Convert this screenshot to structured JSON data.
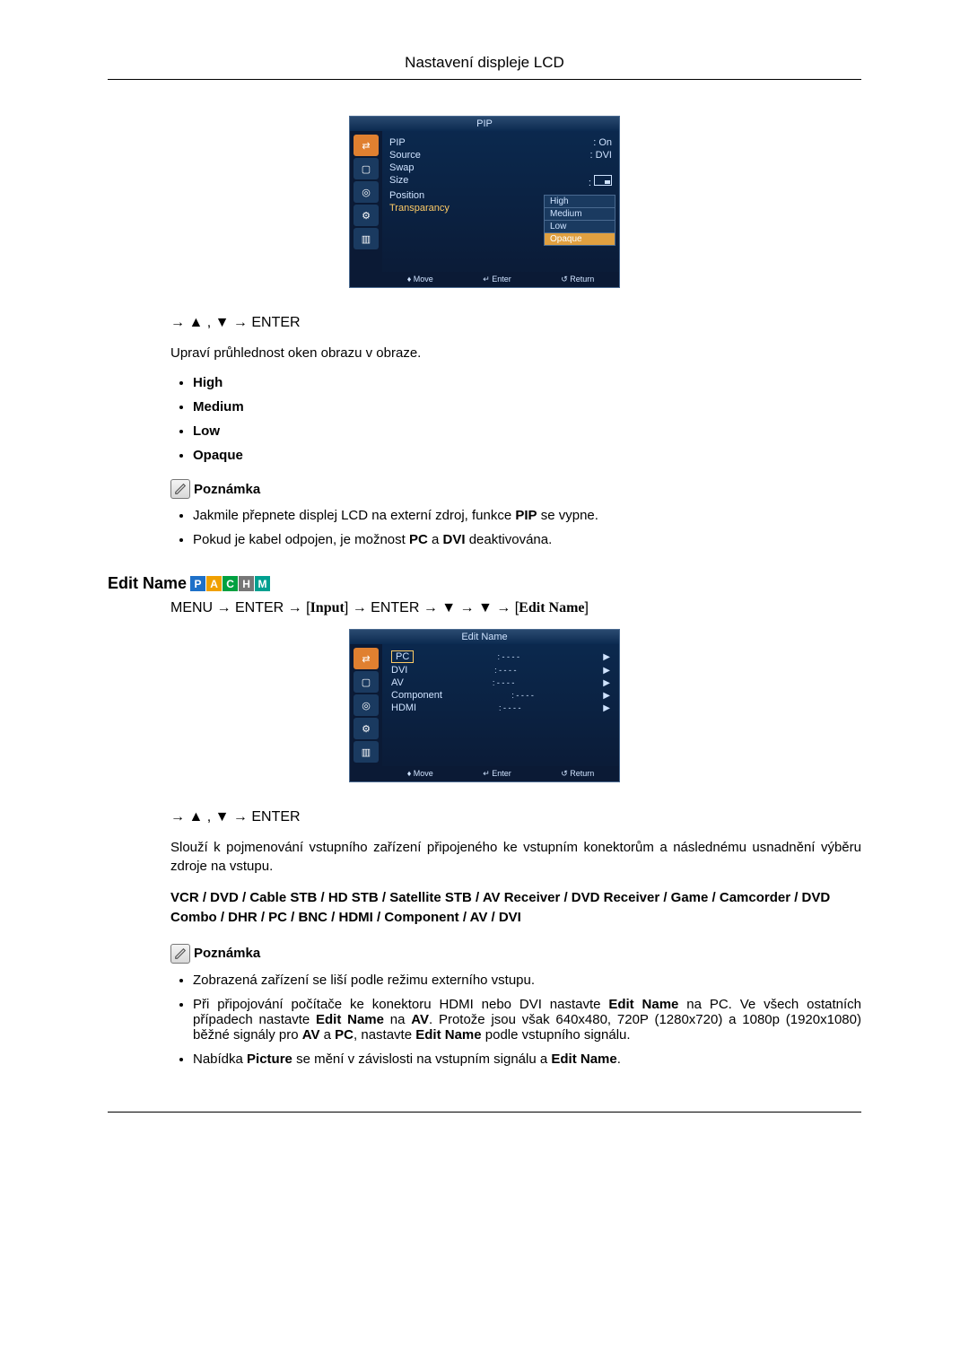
{
  "header": {
    "title": "Nastavení displeje LCD"
  },
  "osd1": {
    "title": "PIP",
    "rows": [
      {
        "label": "PIP",
        "value": "On"
      },
      {
        "label": "Source",
        "value": "DVI"
      },
      {
        "label": "Swap",
        "value": ""
      },
      {
        "label": "Size",
        "value": ""
      },
      {
        "label": "Position",
        "value": ""
      },
      {
        "label": "Transparancy",
        "value": ""
      }
    ],
    "dropdown": [
      "High",
      "Medium",
      "Low",
      "Opaque"
    ],
    "dropdown_selected": "Opaque",
    "footer": {
      "move": "Move",
      "enter": "Enter",
      "return": "Return"
    }
  },
  "nav1": "→ ▲ , ▼ → ENTER",
  "desc1": "Upraví průhlednost oken obrazu v obraze.",
  "options": [
    "High",
    "Medium",
    "Low",
    "Opaque"
  ],
  "note_label": "Poznámka",
  "notes1": [
    {
      "pre": "Jakmile přepnete displej LCD na externí zdroj, funkce ",
      "b1": "PIP",
      "post": " se vypne."
    },
    {
      "pre": "Pokud je kabel odpojen, je možnost ",
      "b1": "PC",
      "mid": " a ",
      "b2": "DVI",
      "post": " deaktivována."
    }
  ],
  "section2": {
    "title": "Edit Name",
    "badges": [
      "P",
      "A",
      "C",
      "H",
      "M"
    ],
    "menu_path": {
      "p1": "MENU → ENTER → [",
      "input": "Input",
      "p2": "] → ENTER → ▼ → ▼ → [",
      "edit": "Edit Name",
      "p3": "]"
    }
  },
  "osd2": {
    "title": "Edit Name",
    "items": [
      "PC",
      "DVI",
      "AV",
      "Component",
      "HDMI"
    ],
    "selected": "PC",
    "footer": {
      "move": "Move",
      "enter": "Enter",
      "return": "Return"
    }
  },
  "nav2": "→ ▲ , ▼ → ENTER",
  "desc2": "Slouží k pojmenování vstupního zařízení připojeného ke vstupním konektorům a následnému usnadnění výběru zdroje na vstupu.",
  "devices": "VCR / DVD / Cable STB / HD STB / Satellite STB / AV Receiver / DVD Receiver / Game / Camcorder / DVD Combo / DHR / PC / BNC / HDMI / Component / AV / DVI",
  "notes2": [
    "Zobrazená zařízení se liší podle režimu externího vstupu."
  ],
  "note2_complex": {
    "t1": "Při připojování počítače ke konektoru HDMI nebo DVI nastavte ",
    "b1": "Edit Name",
    "t2": " na PC. Ve všech ostatních případech nastavte ",
    "b2": "Edit Name",
    "t3": " na ",
    "b3": "AV",
    "t4": ". Protože jsou však 640x480, 720P (1280x720) a 1080p (1920x1080) běžné signály pro ",
    "b4": "AV",
    "t5": " a ",
    "b5": "PC",
    "t6": ", nastavte ",
    "b6": "Edit Name",
    "t7": " podle vstupního signálu."
  },
  "note2_last": {
    "t1": "Nabídka ",
    "b1": "Picture",
    "t2": " se mění v závislosti na vstupním signálu a ",
    "b2": "Edit Name",
    "t3": "."
  }
}
